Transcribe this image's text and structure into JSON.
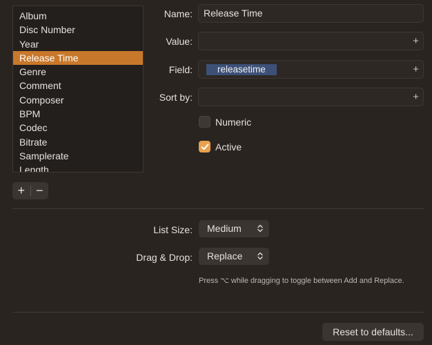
{
  "field_list": {
    "items": [
      "Album",
      "Disc Number",
      "Year",
      "Release Time",
      "Genre",
      "Comment",
      "Composer",
      "BPM",
      "Codec",
      "Bitrate",
      "Samplerate",
      "Length"
    ],
    "selected": "Release Time"
  },
  "list_controls": {
    "add_label": "+",
    "remove_label": "−"
  },
  "form": {
    "name_label": "Name:",
    "name_value": "Release Time",
    "value_label": "Value:",
    "value_value": "",
    "field_label": "Field:",
    "field_token": "releasetime",
    "sortby_label": "Sort by:",
    "sortby_value": "",
    "plus_glyph": "+",
    "numeric_label": "Numeric",
    "numeric_checked": false,
    "active_label": "Active",
    "active_checked": true
  },
  "options": {
    "list_size_label": "List Size:",
    "list_size_value": "Medium",
    "dragdrop_label": "Drag & Drop:",
    "dragdrop_value": "Replace",
    "hint": "Press ⌥ while dragging to toggle between Add and Replace."
  },
  "footer": {
    "reset_label": "Reset to defaults..."
  },
  "colors": {
    "accent": "#c8782b",
    "checkbox_on": "#e9a04e",
    "token_bg": "#3d5178"
  },
  "icons": {
    "popup_chevron": "chevron-up-down-icon",
    "checkmark": "checkmark-icon"
  }
}
